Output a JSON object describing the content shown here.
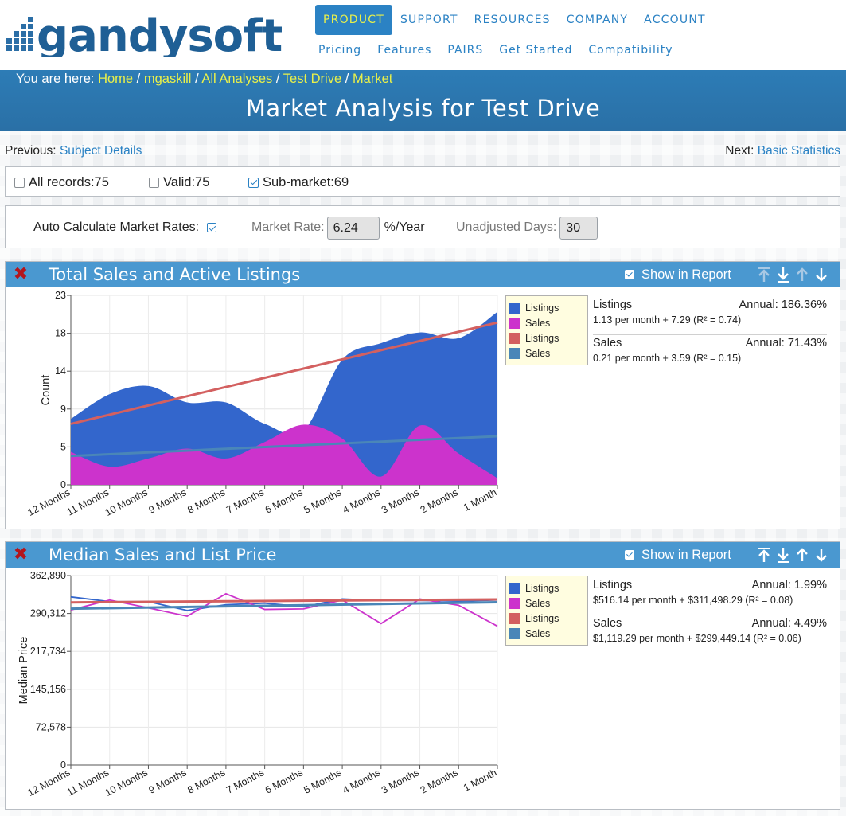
{
  "header": {
    "logo_text": "gandysoft",
    "nav": [
      "PRODUCT",
      "SUPPORT",
      "RESOURCES",
      "COMPANY",
      "ACCOUNT"
    ],
    "subnav": [
      "Pricing",
      "Features",
      "PAIRS",
      "Get Started",
      "Compatibility"
    ]
  },
  "breadcrumb": {
    "prefix": "You are here:",
    "items": [
      "Home",
      "mgaskill",
      "All Analyses",
      "Test Drive",
      "Market"
    ],
    "separator": "/"
  },
  "page": {
    "title": "Market Analysis for Test Drive"
  },
  "prevnext": {
    "prev_label": "Previous:",
    "prev_link": "Subject Details",
    "next_label": "Next:",
    "next_link": "Basic Statistics"
  },
  "filters": [
    {
      "label": "All records:75",
      "checked": false
    },
    {
      "label": "Valid:75",
      "checked": false
    },
    {
      "label": "Sub-market:69",
      "checked": true
    }
  ],
  "rates": {
    "auto_label": "Auto Calculate Market Rates:",
    "auto_checked": true,
    "rate_label": "Market Rate:",
    "rate_value": "6.24",
    "rate_unit": "%/Year",
    "days_label": "Unadjusted Days:",
    "days_value": "30"
  },
  "colors": {
    "listings_fill": "#3366cc",
    "sales_fill": "#cc33cc",
    "listings_trend": "#d36060",
    "sales_trend": "#4a86b8",
    "header_blue": "#4a98d0",
    "link_yellow": "#e9f04a"
  },
  "panels": [
    {
      "title": "Total Sales and Active Listings",
      "show_in_report_label": "Show in Report",
      "show_in_report": true,
      "close_icon": "close-x-icon",
      "arrow_icons": [
        "move-to-top-icon",
        "move-to-bottom-icon",
        "move-up-icon",
        "move-down-icon"
      ],
      "legend": [
        {
          "label": "Listings",
          "color": "#3366cc"
        },
        {
          "label": "Sales",
          "color": "#cc33cc"
        },
        {
          "label": "Listings",
          "color": "#d36060"
        },
        {
          "label": "Sales",
          "color": "#4a86b8"
        }
      ],
      "stats": [
        {
          "name": "Listings",
          "annual": "Annual: 186.36%",
          "equation": "1.13 per month + 7.29 (R² = 0.74)"
        },
        {
          "name": "Sales",
          "annual": "Annual: 71.43%",
          "equation": "0.21 per month + 3.59 (R² = 0.15)"
        }
      ]
    },
    {
      "title": "Median Sales and List Price",
      "show_in_report_label": "Show in Report",
      "show_in_report": true,
      "close_icon": "close-x-icon",
      "arrow_icons": [
        "move-to-top-icon",
        "move-to-bottom-icon",
        "move-up-icon",
        "move-down-icon"
      ],
      "legend": [
        {
          "label": "Listings",
          "color": "#3366cc"
        },
        {
          "label": "Sales",
          "color": "#cc33cc"
        },
        {
          "label": "Listings",
          "color": "#d36060"
        },
        {
          "label": "Sales",
          "color": "#4a86b8"
        }
      ],
      "stats": [
        {
          "name": "Listings",
          "annual": "Annual: 1.99%",
          "equation": "$516.14 per month + $311,498.29 (R² = 0.08)"
        },
        {
          "name": "Sales",
          "annual": "Annual: 4.49%",
          "equation": "$1,119.29 per month + $299,449.14 (R² = 0.06)"
        }
      ]
    }
  ],
  "chart_data": [
    {
      "type": "area",
      "ylabel": "Count",
      "ylim": [
        0,
        23
      ],
      "yticks": [
        "0",
        "5",
        "9",
        "14",
        "18",
        "23"
      ],
      "categories": [
        "12 Months",
        "11 Months",
        "10 Months",
        "9 Months",
        "8 Months",
        "7 Months",
        "6 Months",
        "5 Months",
        "4 Months",
        "3 Months",
        "2 Months",
        "1 Month"
      ],
      "grid": true,
      "series": [
        {
          "name": "Listings",
          "kind": "area",
          "color": "#3366cc",
          "values": [
            8,
            11,
            12,
            10,
            10,
            7.4,
            6.6,
            15.2,
            17.2,
            18.5,
            17.8,
            21
          ]
        },
        {
          "name": "Sales",
          "kind": "area",
          "color": "#cc33cc",
          "values": [
            4,
            2.2,
            3.2,
            4.4,
            3.2,
            5.2,
            7.3,
            5.6,
            1,
            7.2,
            3.8,
            0.8
          ]
        },
        {
          "name": "Listings",
          "kind": "trend",
          "color": "#d36060",
          "values": [
            7.4,
            19.7
          ]
        },
        {
          "name": "Sales",
          "kind": "trend",
          "color": "#4a86b8",
          "values": [
            3.5,
            5.9
          ]
        }
      ]
    },
    {
      "type": "line",
      "ylabel": "Median Price",
      "ylim": [
        0,
        362890
      ],
      "yticks": [
        "0",
        "72,578",
        "145,156",
        "217,734",
        "290,312",
        "362,890"
      ],
      "categories": [
        "12 Months",
        "11 Months",
        "10 Months",
        "9 Months",
        "8 Months",
        "7 Months",
        "6 Months",
        "5 Months",
        "4 Months",
        "3 Months",
        "2 Months",
        "1 Month"
      ],
      "grid": true,
      "series": [
        {
          "name": "Listings",
          "kind": "line",
          "color": "#3366cc",
          "values": [
            322000,
            313000,
            313000,
            296000,
            307000,
            310000,
            303000,
            318000,
            315000,
            315000,
            314000,
            316000
          ]
        },
        {
          "name": "Sales",
          "kind": "line",
          "color": "#cc33cc",
          "values": [
            297000,
            316000,
            301000,
            285000,
            328000,
            298000,
            299000,
            316000,
            271000,
            318000,
            306000,
            266000
          ]
        },
        {
          "name": "Listings",
          "kind": "trend",
          "color": "#d36060",
          "values": [
            311500,
            317200
          ]
        },
        {
          "name": "Sales",
          "kind": "trend",
          "color": "#4a86b8",
          "values": [
            299400,
            311800
          ]
        }
      ]
    }
  ]
}
